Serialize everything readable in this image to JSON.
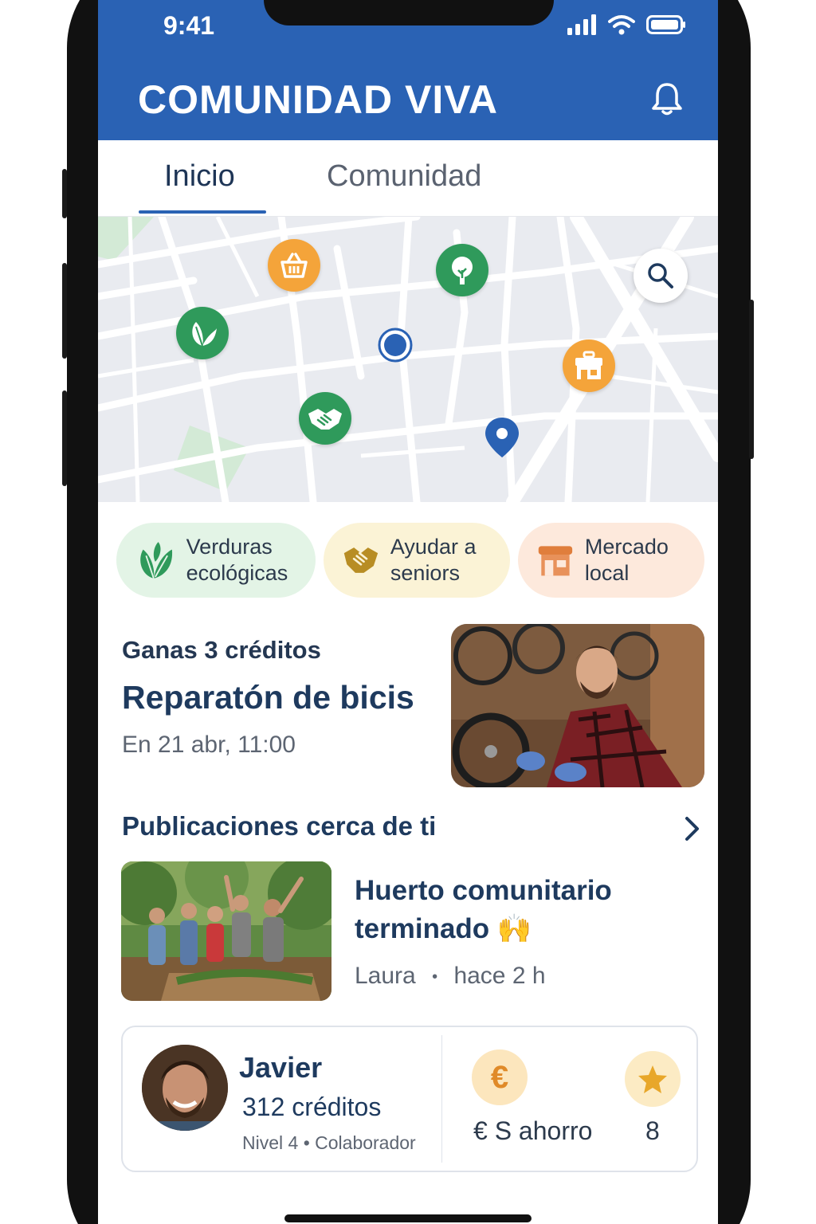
{
  "status_bar": {
    "time": "9:41"
  },
  "app": {
    "title": "COMUNIDAD VIVA"
  },
  "tabs": [
    {
      "label": "Inicio",
      "active": true
    },
    {
      "label": "Comunidad",
      "active": false
    }
  ],
  "map": {
    "pins": [
      {
        "icon": "basket-icon",
        "color": "#f4a43a"
      },
      {
        "icon": "tree-icon",
        "color": "#2f9a5b"
      },
      {
        "icon": "leaves-icon",
        "color": "#2f9a5b"
      },
      {
        "icon": "handshake-icon",
        "color": "#2f9a5b"
      },
      {
        "icon": "shop-icon",
        "color": "#f4a43a"
      }
    ],
    "user_location_icon": "current-location-icon",
    "destination_icon": "map-marker-icon",
    "search_icon": "search-icon"
  },
  "chips": [
    {
      "label": "Verduras ecológicas",
      "icon": "leaf-icon",
      "bg": "#e3f4e6"
    },
    {
      "label": "Ayudar a seniors",
      "icon": "handshake-icon",
      "bg": "#fbf3d6"
    },
    {
      "label": "Mercado local",
      "icon": "store-icon",
      "bg": "#fde9dc"
    }
  ],
  "event": {
    "credits": "Ganas 3 créditos",
    "title": "Reparatón de bicis",
    "date": "En 21 abr, 11:00"
  },
  "posts_section": {
    "title": "Publicaciones cerca de ti",
    "post": {
      "title": "Huerto comunitario terminado 🙌",
      "author": "Laura",
      "time": "hace 2 h"
    }
  },
  "profile": {
    "name": "Javier",
    "credits": "312 créditos",
    "level": "Nivel 4 • Colaborador",
    "savings_label": "€ S ahorro",
    "savings_icon": "euro-icon",
    "stars_value": "8",
    "stars_icon": "star-icon"
  },
  "colors": {
    "header": "#2a62b4",
    "accent_green": "#2f9a5b",
    "accent_orange": "#f4a43a",
    "text_dark": "#1e3a5e"
  }
}
